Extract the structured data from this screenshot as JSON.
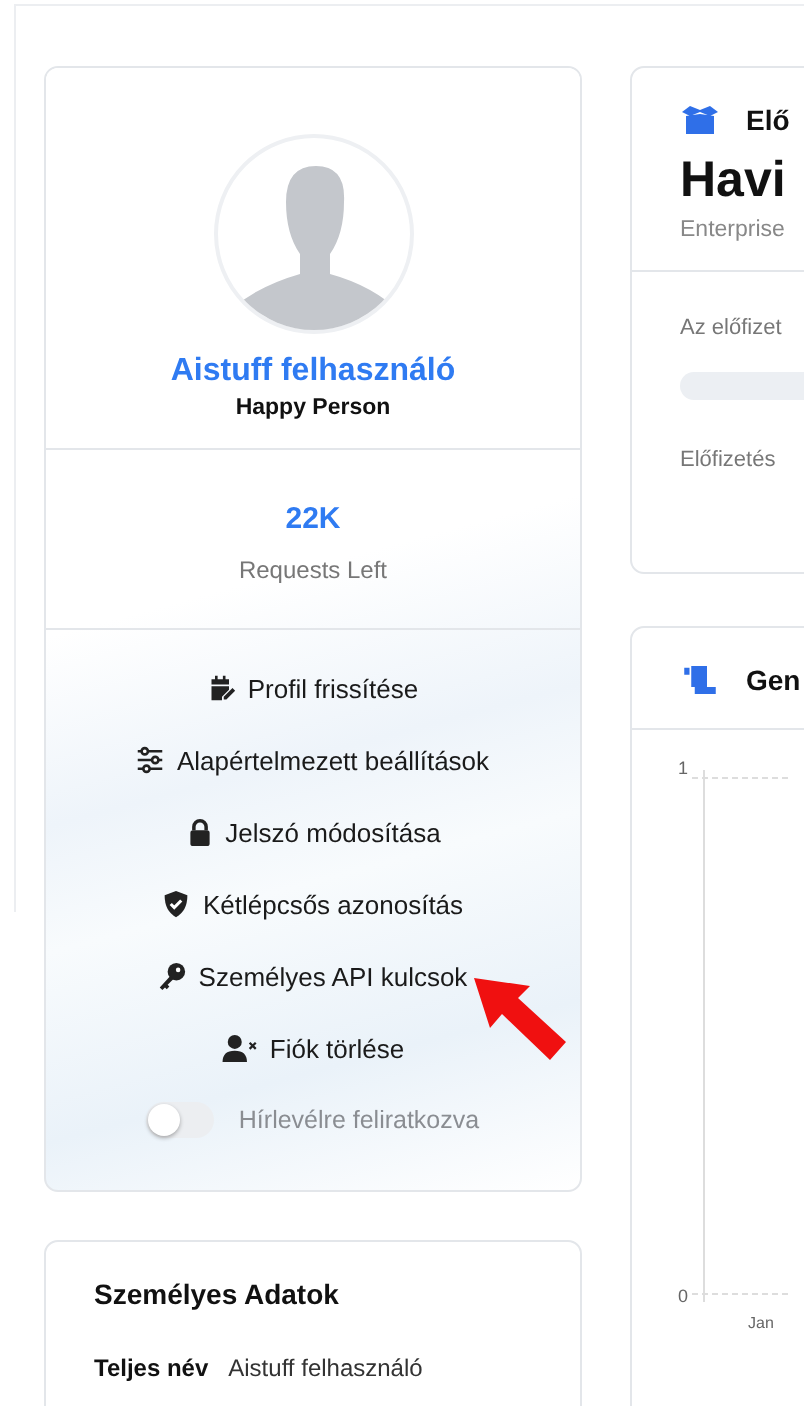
{
  "profile": {
    "name": "Aistuff felhasználó",
    "subtitle": "Happy Person",
    "stat_value": "22K",
    "stat_label": "Requests Left",
    "menu": [
      {
        "kind": "edit",
        "label": "Profil frissítése"
      },
      {
        "kind": "sliders",
        "label": "Alapértelmezett beállítások"
      },
      {
        "kind": "lock",
        "label": "Jelszó módosítása"
      },
      {
        "kind": "shield",
        "label": "Kétlépcsős azonosítás"
      },
      {
        "kind": "key",
        "label": "Személyes API kulcsok"
      },
      {
        "kind": "user-x",
        "label": "Fiók törlése"
      }
    ],
    "newsletter": {
      "label": "Hírlevélre feliratkozva",
      "on": false
    }
  },
  "personal": {
    "title": "Személyes Adatok",
    "rows": [
      {
        "label": "Teljes név",
        "value": "Aistuff felhasználó"
      }
    ]
  },
  "subscription": {
    "title": "Elő",
    "plan": "Havi",
    "tier": "Enterprise",
    "usage_label": "Az előfizet",
    "usage": {
      "level": 0
    },
    "footer": "Előfizetés"
  },
  "generations": {
    "title": "Gen",
    "y_ticks": [
      "1",
      "0"
    ],
    "x_labels": [
      "Jan"
    ]
  }
}
